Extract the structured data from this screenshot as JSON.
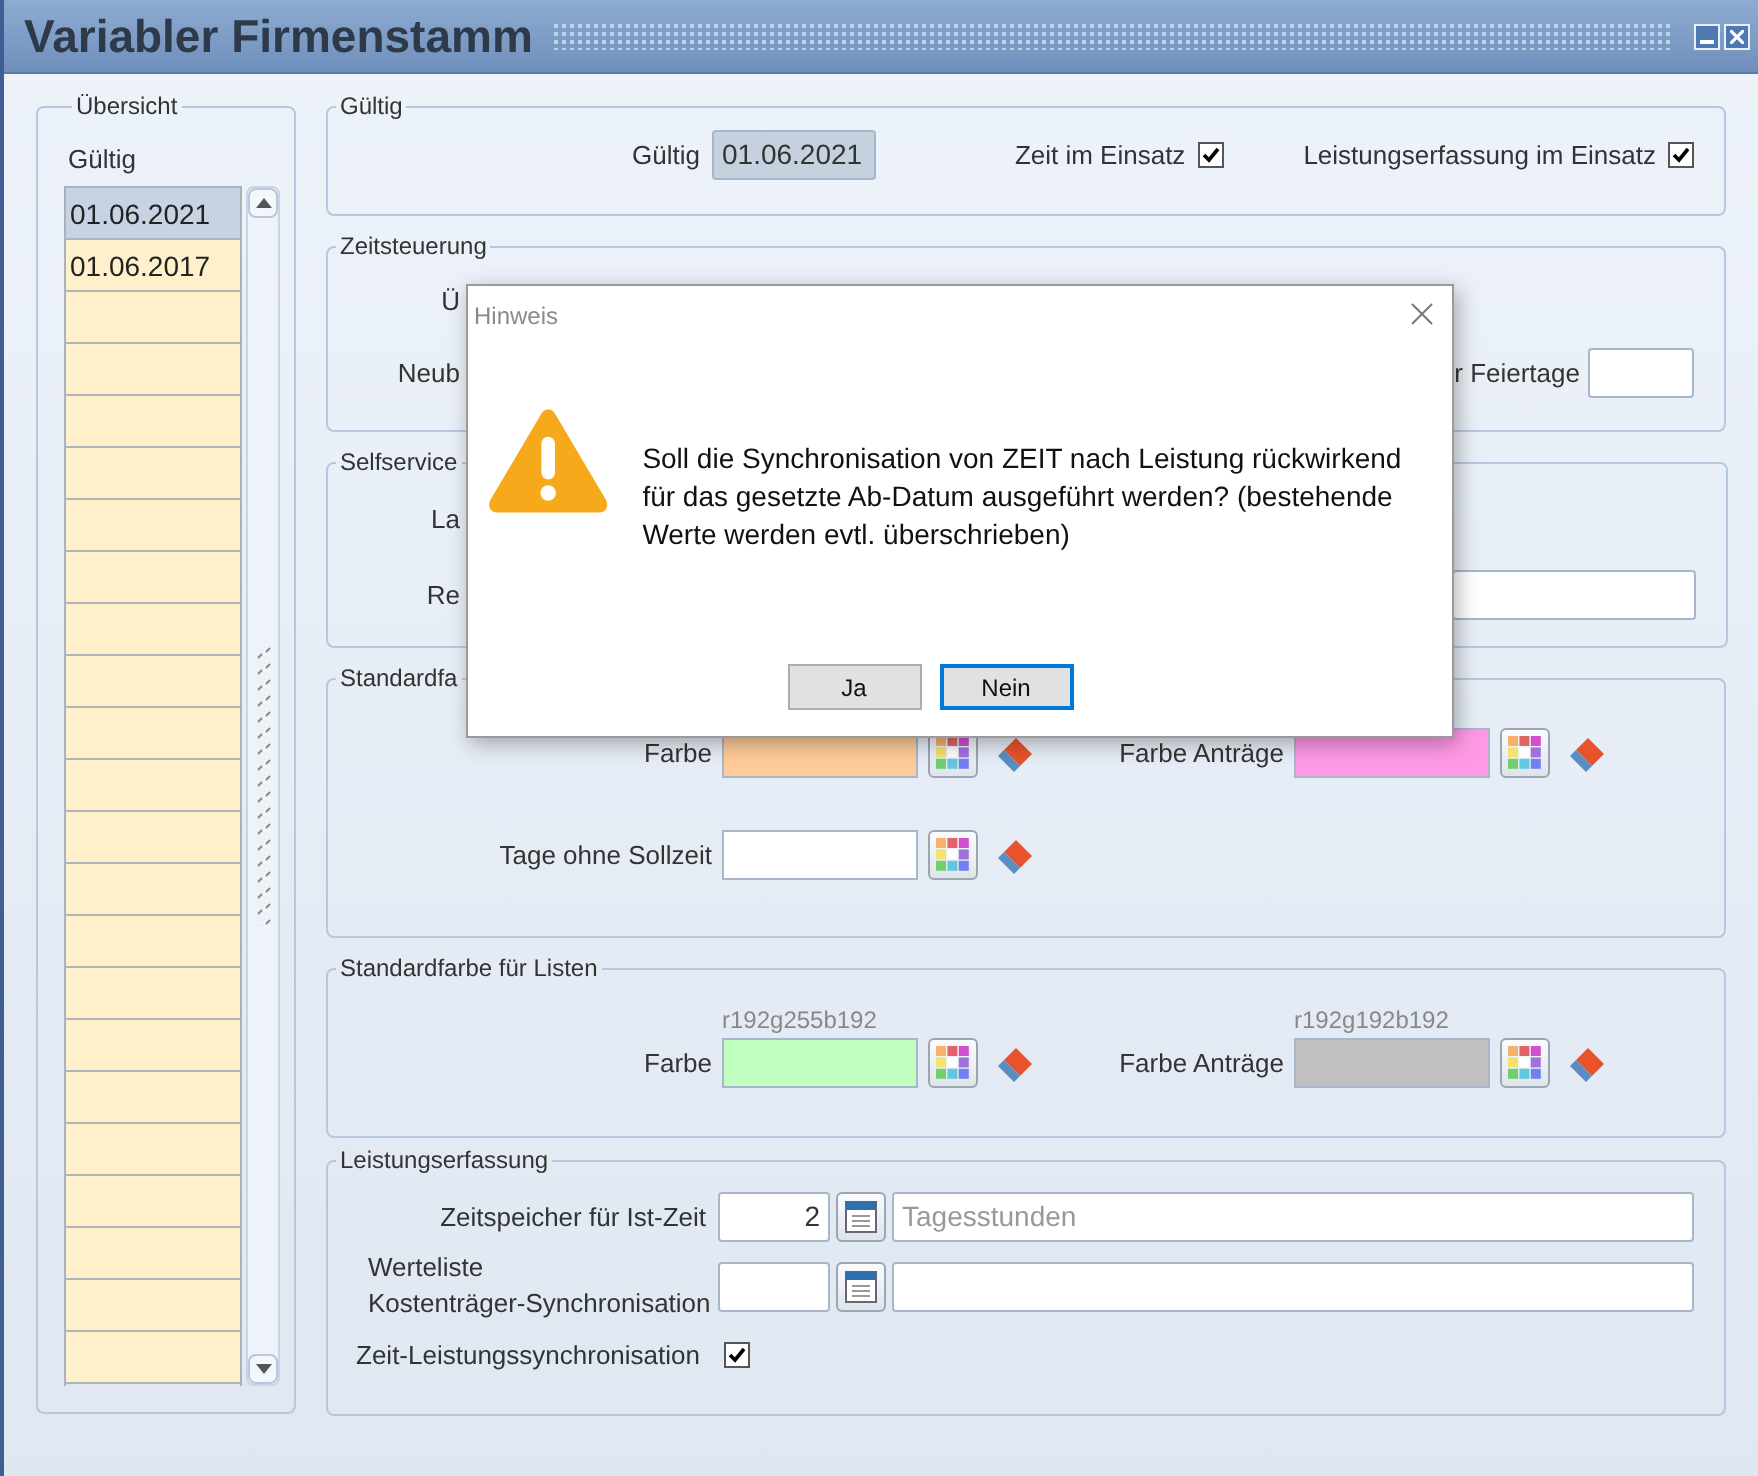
{
  "window": {
    "title": "Variabler Firmenstamm"
  },
  "overview": {
    "legend": "Übersicht",
    "column": "Gültig",
    "rows": [
      {
        "value": "01.06.2021",
        "selected": true
      },
      {
        "value": "01.06.2017",
        "selected": false
      }
    ]
  },
  "validity": {
    "legend": "Gültig",
    "label": "Gültig",
    "value": "01.06.2021",
    "disabled": true,
    "checks": [
      {
        "label": "Zeit im Einsatz",
        "checked": true
      },
      {
        "label": "Leistungserfassung im Einsatz",
        "checked": true
      }
    ]
  },
  "time_control": {
    "legend": "Zeitsteuerung",
    "labels": [
      "Ü",
      "Neub"
    ],
    "holiday_label": "r Feiertage"
  },
  "selfservice": {
    "legend": "Selfservice",
    "labels": [
      "La",
      "Re"
    ]
  },
  "colors": {
    "legend": "Standardfa",
    "swatches": [
      {
        "label": "Farbe",
        "color": "#ffcc99"
      },
      {
        "label": "Farbe Anträge",
        "color": "#ff99e6"
      },
      {
        "label": "Tage ohne Sollzeit",
        "color": "#ffffff"
      }
    ]
  },
  "list_colors": {
    "legend": "Standardfarbe für Listen",
    "swatches": [
      {
        "label": "Farbe",
        "caption": "r192g255b192",
        "color": "#c0ffc0"
      },
      {
        "label": "Farbe Anträge",
        "caption": "r192g192b192",
        "color": "#c0c0c0"
      }
    ]
  },
  "performance": {
    "legend": "Leistungserfassung",
    "storage": {
      "label": "Zeitspeicher für Ist-Zeit",
      "value": "2",
      "placeholder": "Tagesstunden"
    },
    "value_list": {
      "label_lines": [
        "Werteliste",
        "Kostenträger-Synchronisation"
      ]
    },
    "sync": {
      "label": "Zeit-Leistungssynchronisation",
      "checked": true
    }
  },
  "dialog": {
    "title": "Hinweis",
    "message": "Soll die Synchronisation von ZEIT nach Leistung rückwirkend für das gesetzte Ab-Datum ausgeführt werden? (bestehende Werte werden evtl. überschrieben)",
    "buttons": [
      {
        "label": "Ja",
        "selected": false
      },
      {
        "label": "Nein",
        "selected": true
      }
    ]
  }
}
